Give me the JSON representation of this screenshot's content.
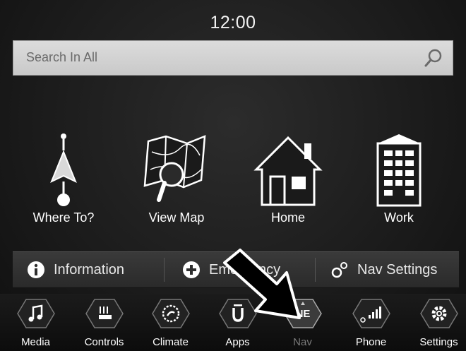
{
  "status": {
    "time": "12:00"
  },
  "search": {
    "placeholder": "Search In All"
  },
  "tiles": [
    {
      "label": "Where To?",
      "icon": "navigation-pointer-icon"
    },
    {
      "label": "View Map",
      "icon": "map-magnifier-icon"
    },
    {
      "label": "Home",
      "icon": "house-icon"
    },
    {
      "label": "Work",
      "icon": "office-building-icon"
    }
  ],
  "actions": [
    {
      "label": "Information",
      "icon": "info-icon"
    },
    {
      "label": "Emergency",
      "icon": "plus-circle-icon"
    },
    {
      "label": "Nav Settings",
      "icon": "gears-icon"
    }
  ],
  "bottom_nav": [
    {
      "label": "Media",
      "icon": "music-note-icon"
    },
    {
      "label": "Controls",
      "icon": "seat-heat-icon"
    },
    {
      "label": "Climate",
      "icon": "climate-icon"
    },
    {
      "label": "Apps",
      "icon": "apps-u-icon"
    },
    {
      "label": "Nav",
      "icon": "compass-icon",
      "compass": "NE",
      "active": true
    },
    {
      "label": "Phone",
      "icon": "phone-signal-icon"
    },
    {
      "label": "Settings",
      "icon": "gear-icon"
    }
  ],
  "colors": {
    "background": "#1c1c1c",
    "search_bg": "#d2d2d2",
    "text": "#ffffff",
    "dim_text": "#7a7a7a"
  }
}
